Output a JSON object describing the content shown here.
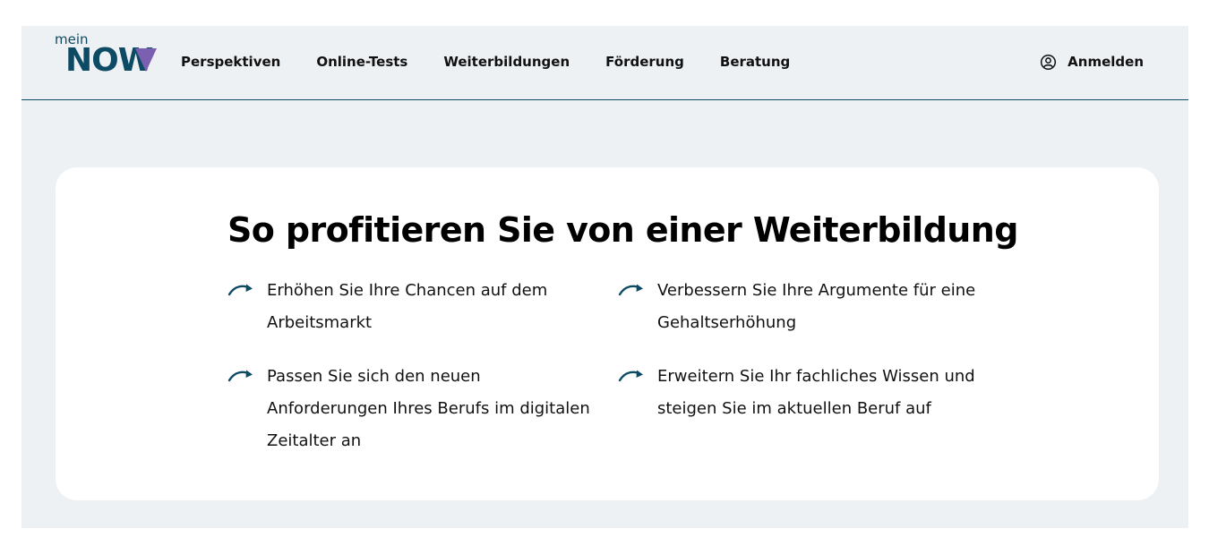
{
  "header": {
    "logo": {
      "prefix": "mein",
      "name": "NOW"
    },
    "nav": [
      {
        "label": "Perspektiven"
      },
      {
        "label": "Online-Tests"
      },
      {
        "label": "Weiterbildungen"
      },
      {
        "label": "Förderung"
      },
      {
        "label": "Beratung"
      }
    ],
    "login_label": "Anmelden"
  },
  "main": {
    "title": "So profitieren Sie von einer Weiterbildung",
    "benefits": [
      {
        "text": "Erhöhen Sie Ihre Chancen auf dem Arbeitsmarkt"
      },
      {
        "text": "Verbessern Sie Ihre Argumente für eine Gehaltserhöhung"
      },
      {
        "text": "Passen Sie sich den neuen Anforderungen Ihres Berufs im digitalen Zeitalter an"
      },
      {
        "text": "Erweitern Sie Ihr fachliches Wissen und steigen Sie im aktuellen Beruf auf"
      }
    ]
  },
  "colors": {
    "brand": "#0d4a63",
    "accent": "#7b5fb0",
    "background": "#eef1f4",
    "card": "#ffffff"
  },
  "icons": {
    "benefit": "arrow-curve-right-icon",
    "login": "user-circle-icon"
  }
}
